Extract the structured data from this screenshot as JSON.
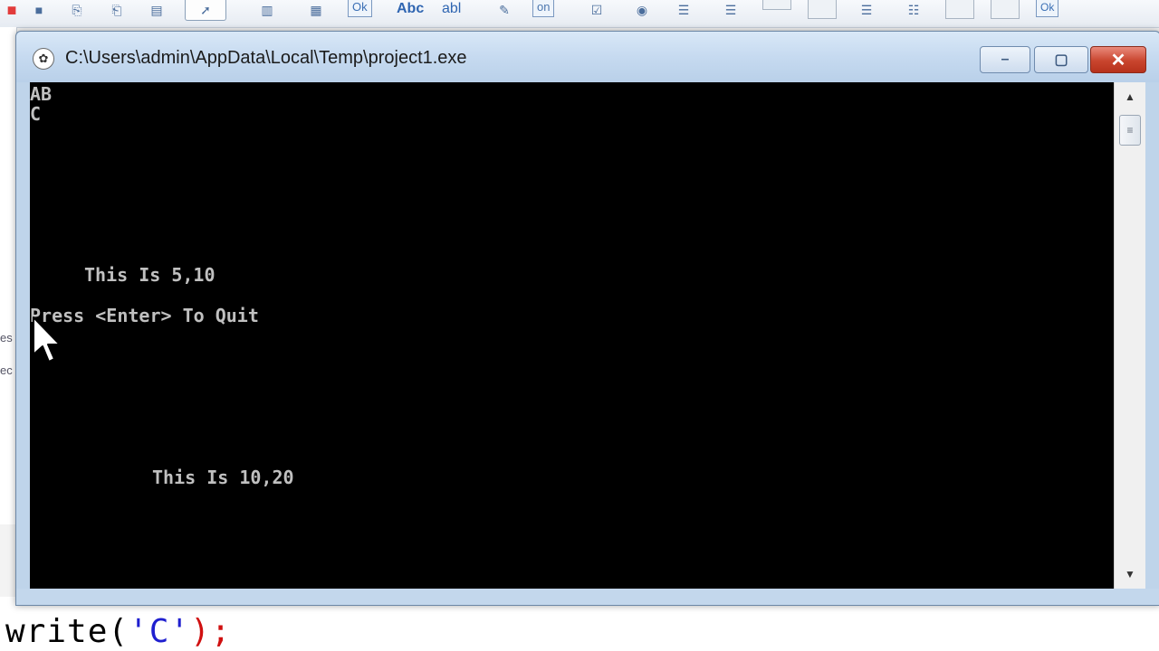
{
  "ide": {
    "toolbar_texts": {
      "ok1": "Ok",
      "abc": "Abc",
      "abl": "abl",
      "on": "on",
      "ok2": "Ok"
    },
    "left_fragments": [
      "es",
      "ec"
    ],
    "code_parts": {
      "ident": "write(",
      "str": "'C'",
      "close": ");"
    }
  },
  "console": {
    "title": "C:\\Users\\admin\\AppData\\Local\\Temp\\project1.exe",
    "lines": [
      "AB",
      "C",
      "This Is 5,10",
      "Press <Enter> To Quit",
      "This Is 10,20"
    ],
    "buttons": {
      "minimize": "–",
      "maximize": "▢",
      "close": "✕"
    }
  },
  "colors": {
    "console_bg": "#000000",
    "console_text": "#c0c0c0",
    "close_button": "#c9452e",
    "titlebar": "#c6daf0"
  },
  "icons": [
    "stop-icon",
    "new-unit-icon",
    "open-icon",
    "save-icon",
    "pointer-icon",
    "label-icon",
    "edit-icon",
    "checkbox-icon",
    "radio-icon",
    "list-icon",
    "scroll-up-arrow-icon",
    "scroll-down-arrow-icon",
    "grip-icon",
    "app-icon",
    "mouse-cursor-icon"
  ]
}
